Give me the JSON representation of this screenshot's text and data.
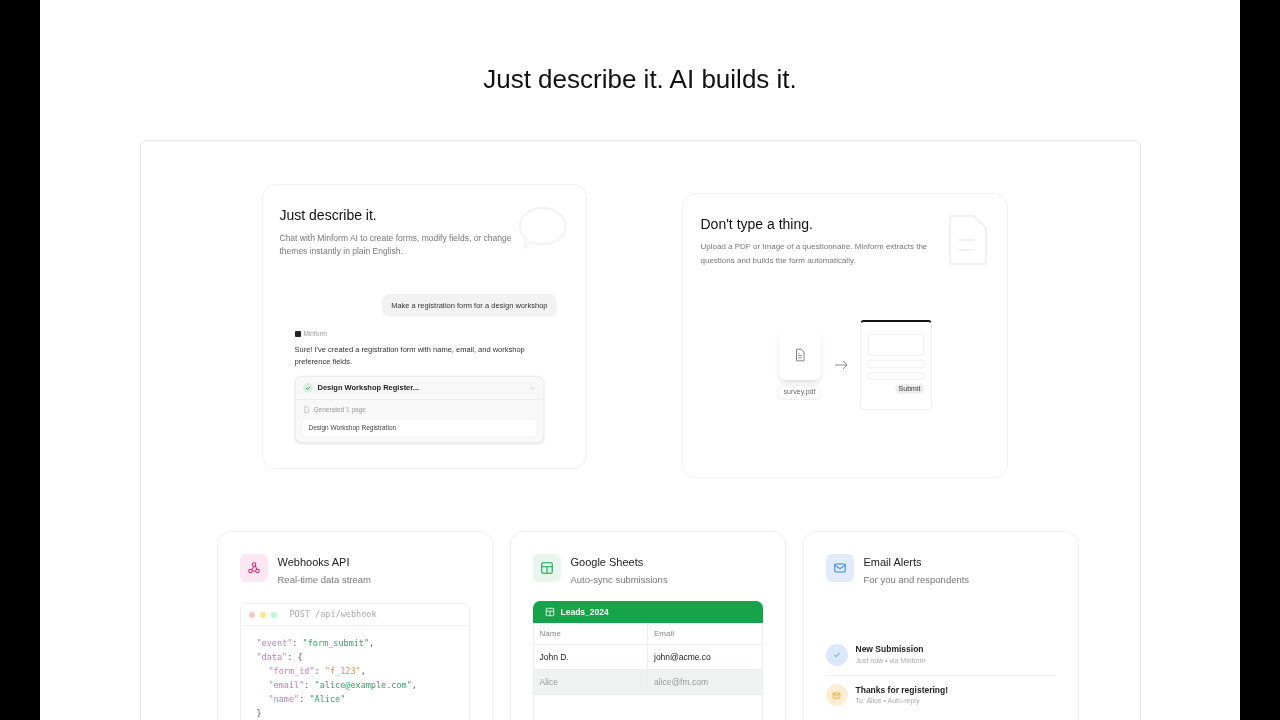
{
  "heading": "Just describe it. AI builds it.",
  "chat_card": {
    "title": "Just describe it.",
    "description": "Chat with Minform AI to create forms, modify fields, or change themes instantly in plain English.",
    "user_message": "Make a registration form for a design workshop",
    "bot_name": "Minform",
    "bot_message": "Sure! I've created a registration form with name, email, and workshop preference fields.",
    "result": {
      "title": "Design Workshop Register...",
      "expanded": true,
      "status": "Generated 1 page",
      "page": "Design Workshop Registration"
    }
  },
  "upload_card": {
    "title": "Don't type a thing.",
    "description": "Upload a PDF or Image of a questionnaire. Minform extracts the questions and builds the form automatically.",
    "file_name": "survey.pdf",
    "submit_label": "Submit"
  },
  "features": [
    {
      "kind": "webhooks",
      "title": "Webhooks API",
      "subtitle": "Real-time data stream",
      "endpoint": "POST /api/webhook",
      "code": [
        {
          "parts": [
            {
              "kind": "key",
              "text": "\"event\""
            },
            {
              "kind": "punct",
              "text": ": "
            },
            {
              "kind": "string",
              "text": "\"form_submit\""
            },
            {
              "kind": "punct",
              "text": ","
            }
          ]
        },
        {
          "parts": [
            {
              "kind": "key",
              "text": "\"data\""
            },
            {
              "kind": "punct",
              "text": ": {"
            }
          ],
          "children": [
            {
              "parts": [
                {
                  "kind": "key",
                  "text": "\"form_id\""
                },
                {
                  "kind": "punct",
                  "text": ": "
                },
                {
                  "kind": "id",
                  "text": "\"f_123\""
                },
                {
                  "kind": "punct",
                  "text": ","
                }
              ]
            },
            {
              "parts": [
                {
                  "kind": "key",
                  "text": "\"email\""
                },
                {
                  "kind": "punct",
                  "text": ": "
                },
                {
                  "kind": "string",
                  "text": "\"alice@example.com\""
                },
                {
                  "kind": "punct",
                  "text": ","
                }
              ]
            },
            {
              "parts": [
                {
                  "kind": "key",
                  "text": "\"name\""
                },
                {
                  "kind": "punct",
                  "text": ": "
                },
                {
                  "kind": "string",
                  "text": "\"Alice\""
                }
              ]
            }
          ]
        },
        {
          "parts": [
            {
              "kind": "punct",
              "text": "}"
            }
          ]
        }
      ]
    },
    {
      "kind": "sheets",
      "title": "Google Sheets",
      "subtitle": "Auto-sync submissions",
      "sheet_name": "Leads_2024",
      "columns": [
        "Name",
        "Email"
      ],
      "rows": [
        {
          "cells": [
            "John D.",
            "john@acme.co"
          ],
          "selected": false
        },
        {
          "cells": [
            "Alice",
            "alice@fm.com"
          ],
          "selected": true
        }
      ]
    },
    {
      "kind": "email",
      "title": "Email Alerts",
      "subtitle": "For you and respondents",
      "alerts": [
        {
          "kind": "check",
          "color": "#dbe8fb",
          "title": "New Submission",
          "meta": "Just now • via Minform"
        },
        {
          "kind": "mail",
          "color": "#fdedd5",
          "title": "Thanks for registering!",
          "meta": "To: Alice • Auto-reply"
        }
      ]
    }
  ]
}
